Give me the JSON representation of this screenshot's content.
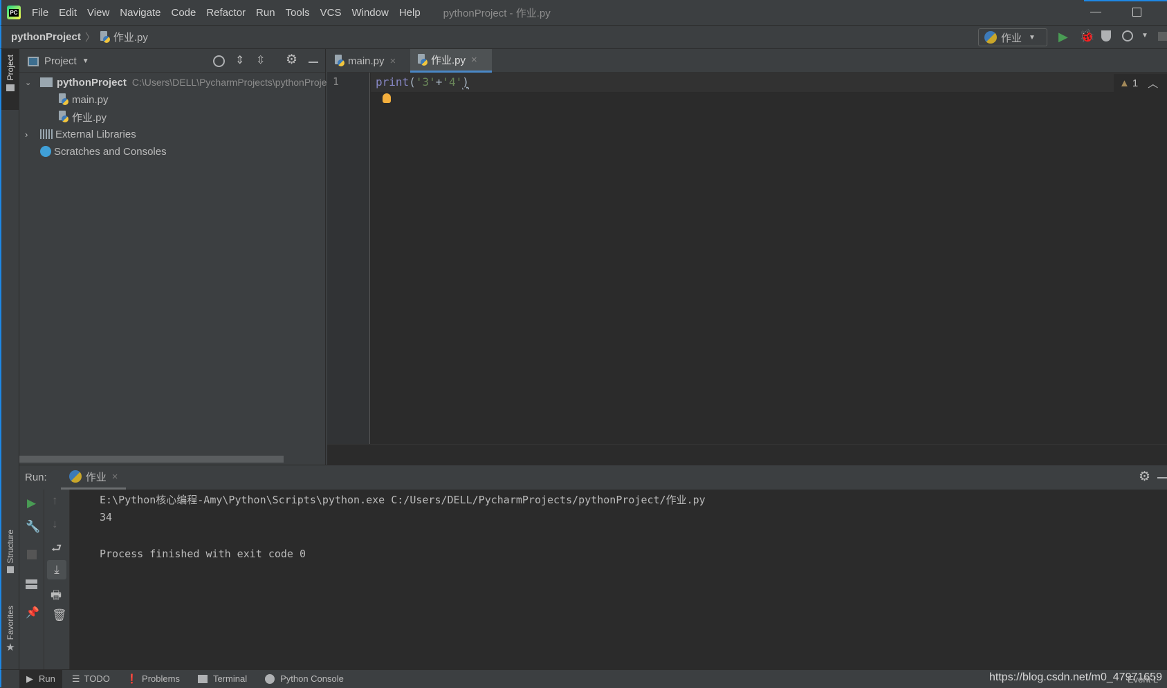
{
  "window": {
    "title": "pythonProject - 作业.py",
    "app_icon": "PC"
  },
  "menu": [
    "File",
    "Edit",
    "View",
    "Navigate",
    "Code",
    "Refactor",
    "Run",
    "Tools",
    "VCS",
    "Window",
    "Help"
  ],
  "breadcrumb": {
    "project": "pythonProject",
    "file": "作业.py"
  },
  "run_config": {
    "label": "作业"
  },
  "left_strip": {
    "project": "Project",
    "structure": "Structure",
    "favorites": "Favorites"
  },
  "project_panel": {
    "title": "Project",
    "root": {
      "name": "pythonProject",
      "path": "C:\\Users\\DELL\\PycharmProjects\\pythonProject"
    },
    "files": [
      "main.py",
      "作业.py"
    ],
    "external": "External Libraries",
    "scratches": "Scratches and Consoles"
  },
  "editor": {
    "tabs": [
      {
        "label": "main.py",
        "active": false
      },
      {
        "label": "作业.py",
        "active": true
      }
    ],
    "line_numbers": [
      "1"
    ],
    "code": {
      "fn": "print",
      "open": "(",
      "s1": "'3'",
      "plus": "+",
      "s2": "'4'",
      "close": ")"
    },
    "warnings": "1"
  },
  "run_panel": {
    "label": "Run:",
    "tab": "作业",
    "output": [
      "E:\\Python核心编程-Amy\\Python\\Scripts\\python.exe C:/Users/DELL/PycharmProjects/pythonProject/作业.py",
      "34",
      "",
      "Process finished with exit code 0"
    ]
  },
  "statusbar": {
    "tabs": [
      "Run",
      "TODO",
      "Problems",
      "Terminal",
      "Python Console"
    ],
    "event_log": "Event L",
    "watermark": "https://blog.csdn.net/m0_47971659"
  },
  "colors": {
    "accent": "#4a88c7",
    "run_green": "#499c54",
    "editor_bg": "#2b2b2b",
    "panel_bg": "#3c3f41",
    "keyword": "#8888c6",
    "string": "#6a8759"
  }
}
